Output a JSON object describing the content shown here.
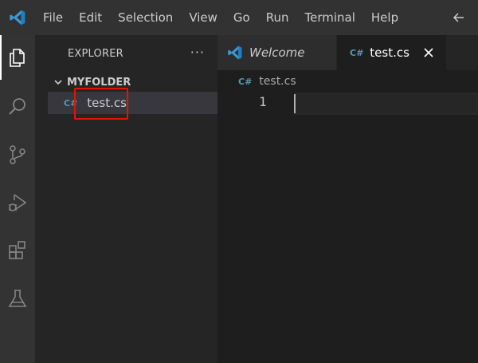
{
  "menu": {
    "items": [
      "File",
      "Edit",
      "Selection",
      "View",
      "Go",
      "Run",
      "Terminal",
      "Help"
    ]
  },
  "activity_bar": {
    "icons": [
      "explorer-icon",
      "search-icon",
      "source-control-icon",
      "run-debug-icon",
      "extensions-icon",
      "testing-icon"
    ]
  },
  "explorer": {
    "title": "EXPLORER",
    "more_actions": "···",
    "folder": "MYFOLDER",
    "file": "test.cs",
    "file_icon": "C#"
  },
  "tabs": [
    {
      "label": "Welcome",
      "active": false
    },
    {
      "label": "test.cs",
      "active": true
    }
  ],
  "breadcrumb": {
    "file": "test.cs"
  },
  "editor": {
    "line_number": "1"
  },
  "colors": {
    "accent_blue": "#3c99d4",
    "csharp_icon": "#519aba",
    "highlight_red": "#e51400"
  }
}
